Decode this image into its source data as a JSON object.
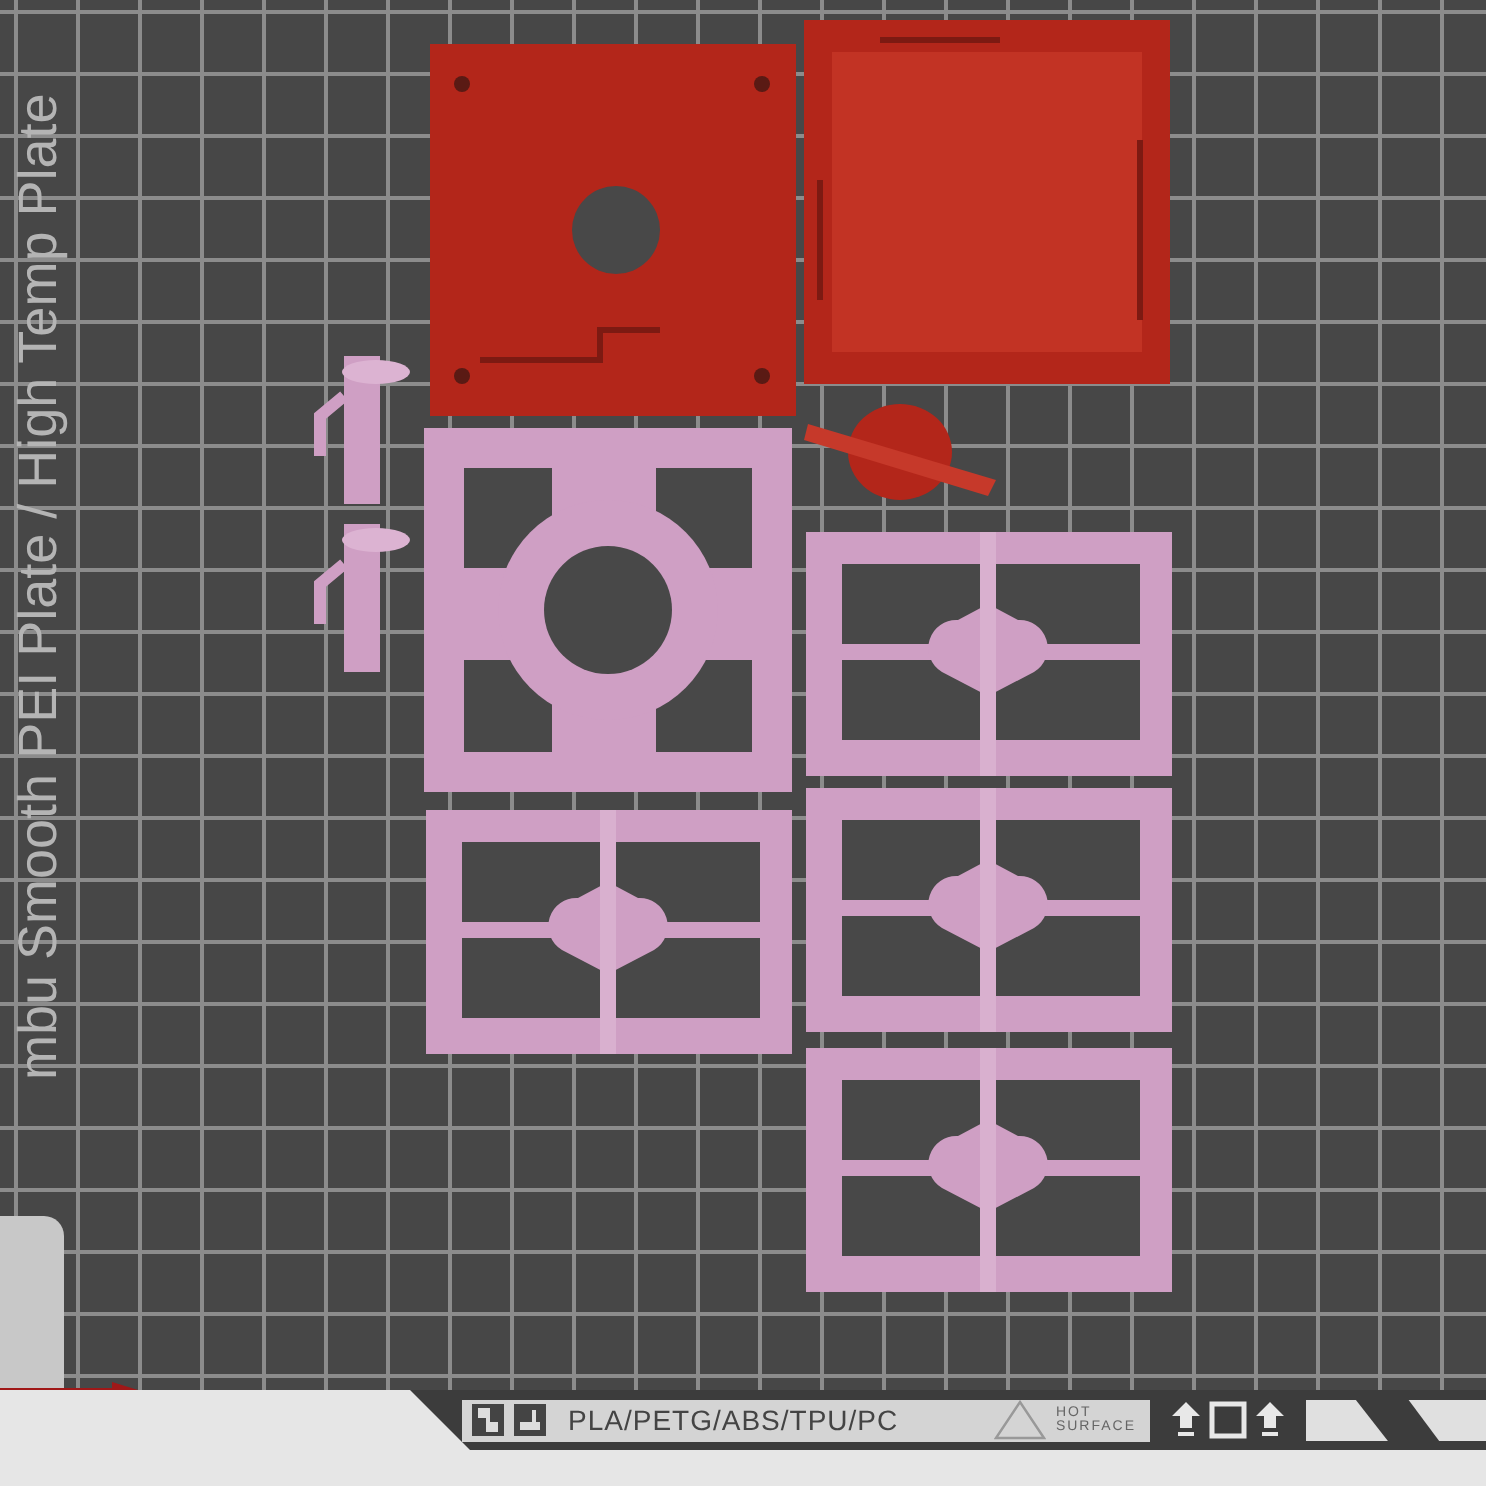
{
  "plate": {
    "name": "mbu Smooth PEI Plate / High Temp Plate"
  },
  "label": {
    "materials": "PLA/PETG/ABS/TPU/PC",
    "warning": "HOT SURFACE"
  }
}
